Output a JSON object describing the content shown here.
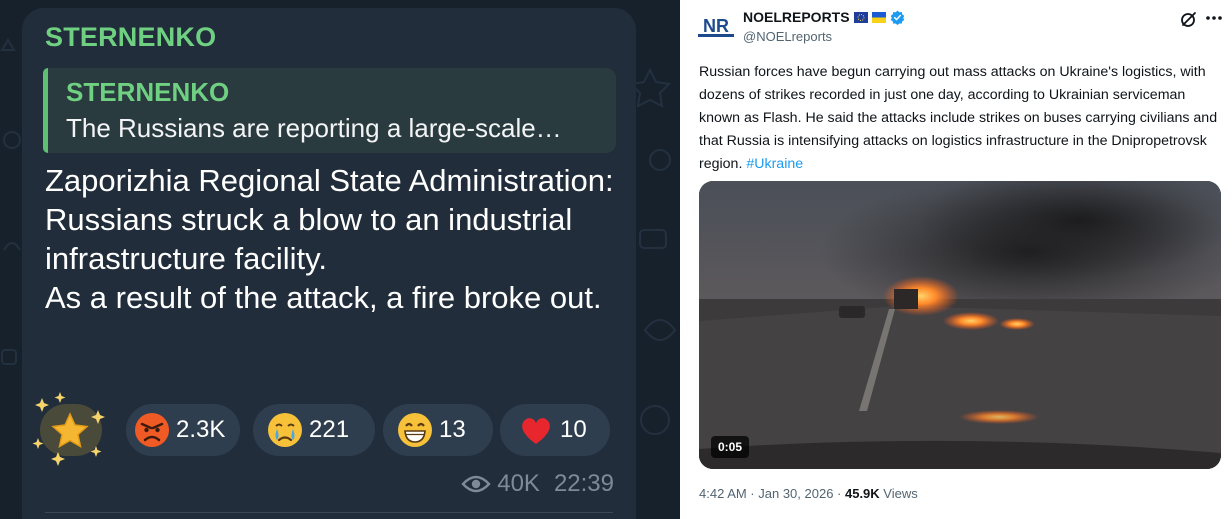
{
  "telegram": {
    "author": "STERNENKO",
    "reply": {
      "author": "STERNENKO",
      "text": "The Russians are reporting a large-scale…"
    },
    "body": [
      "Zaporizhia Regional State Administration: Russians struck a blow to an industrial infrastructure facility.",
      "As a result of the attack, a fire broke out."
    ],
    "reactions": [
      {
        "icon": "star-sparkle-icon",
        "count": ""
      },
      {
        "icon": "angry-face-icon",
        "count": "2.3K"
      },
      {
        "icon": "crying-face-icon",
        "count": "221"
      },
      {
        "icon": "grinning-face-icon",
        "count": "13"
      },
      {
        "icon": "red-heart-icon",
        "count": "10"
      }
    ],
    "views": "40K",
    "time": "22:39",
    "colors": {
      "background": "#17212b",
      "bubble": "#212d3b",
      "author": "#6fd082"
    }
  },
  "tweet": {
    "display_name": "NOELREPORTS",
    "handle": "@NOELreports",
    "avatar_text": "NR",
    "text": "Russian forces have begun carrying out mass attacks on Ukraine's logistics, with dozens of strikes recorded in just one day, according to Ukrainian serviceman known as Flash. He said the attacks include strikes on buses carrying civilians and that Russia is intensifying attacks on logistics infrastructure in the Dnipropetrovsk region.",
    "hashtag": "#Ukraine",
    "video_duration": "0:05",
    "timestamp": "4:42 AM · Jan 30, 2026 · ",
    "views_count": "45.9K",
    "views_label": " Views",
    "colors": {
      "link": "#1d9bf0",
      "verified": "#1d9bf0",
      "muted": "#536471"
    }
  }
}
